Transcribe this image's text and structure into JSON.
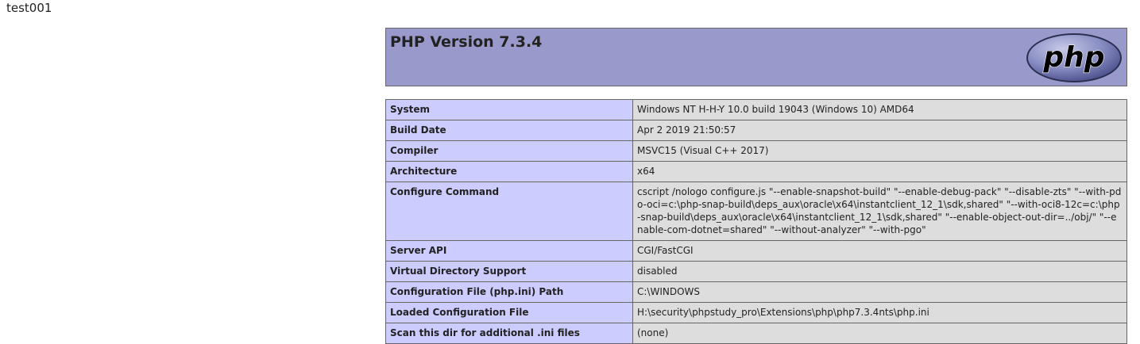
{
  "page": {
    "top_text": "test001"
  },
  "header": {
    "title": "PHP Version 7.3.4",
    "logo_text": "php"
  },
  "colors": {
    "header_bg": "#9999cc",
    "label_bg": "#ccccff",
    "value_bg": "#dddddd",
    "border": "#666666"
  },
  "info_rows": [
    {
      "label": "System",
      "value": "Windows NT H-H-Y 10.0 build 19043 (Windows 10) AMD64"
    },
    {
      "label": "Build Date",
      "value": "Apr 2 2019 21:50:57"
    },
    {
      "label": "Compiler",
      "value": "MSVC15 (Visual C++ 2017)"
    },
    {
      "label": "Architecture",
      "value": "x64"
    },
    {
      "label": "Configure Command",
      "value": "cscript /nologo configure.js \"--enable-snapshot-build\" \"--enable-debug-pack\" \"--disable-zts\" \"--with-pdo-oci=c:\\php-snap-build\\deps_aux\\oracle\\x64\\instantclient_12_1\\sdk,shared\" \"--with-oci8-12c=c:\\php-snap-build\\deps_aux\\oracle\\x64\\instantclient_12_1\\sdk,shared\" \"--enable-object-out-dir=../obj/\" \"--enable-com-dotnet=shared\" \"--without-analyzer\" \"--with-pgo\""
    },
    {
      "label": "Server API",
      "value": "CGI/FastCGI"
    },
    {
      "label": "Virtual Directory Support",
      "value": "disabled"
    },
    {
      "label": "Configuration File (php.ini) Path",
      "value": "C:\\WINDOWS"
    },
    {
      "label": "Loaded Configuration File",
      "value": "H:\\security\\phpstudy_pro\\Extensions\\php\\php7.3.4nts\\php.ini"
    },
    {
      "label": "Scan this dir for additional .ini files",
      "value": "(none)"
    }
  ]
}
